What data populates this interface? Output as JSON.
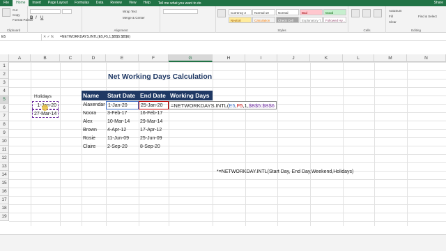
{
  "ribbon_tabs": [
    "File",
    "Home",
    "Insert",
    "Page Layout",
    "Formulas",
    "Data",
    "Review",
    "View",
    "Help"
  ],
  "active_tab": "Home",
  "tell_me": "Tell me what you want to do",
  "share": "Share",
  "clipboard": {
    "cut": "Cut",
    "copy": "Copy",
    "format_painter": "Format Painter",
    "label": "Clipboard"
  },
  "alignment": {
    "wrap": "Wrap Text",
    "merge": "Merge & Center",
    "label": "Alignment"
  },
  "styles": {
    "items": [
      "Currency 2",
      "Normal 10",
      "Normal",
      "Bad",
      "Good",
      "Neutral",
      "Calculation",
      "Check Cell",
      "Explanatory T...",
      "Followed Hy..."
    ],
    "cond": "Conditional Formatting",
    "format_table": "Format as Table",
    "label": "Styles"
  },
  "cells_group": {
    "label": "Cells"
  },
  "editing": {
    "autosum": "AutoSum",
    "fill": "Fill",
    "clear": "Clear",
    "sort": "Sort & Filter",
    "find": "Find & Select",
    "label": "Editing"
  },
  "name_box": "E5",
  "formula": "=NETWORKDAYS.INTL(E5,F5,1,$B$5:$B$6)",
  "columns": [
    "A",
    "B",
    "C",
    "D",
    "E",
    "F",
    "G",
    "H",
    "I",
    "J",
    "K",
    "L",
    "M",
    "N"
  ],
  "rows": [
    "1",
    "2",
    "3",
    "4",
    "5",
    "6",
    "7",
    "8",
    "9",
    "10",
    "11",
    "12",
    "13",
    "14",
    "15",
    "16",
    "17",
    "18",
    "19"
  ],
  "sheet": {
    "title": "Net Working Days Calculation",
    "holidays_label": "Holidays",
    "holidays": [
      "1-Jan-20",
      "27-Mar-14"
    ],
    "headers": [
      "Name",
      "Start Date",
      "End Date",
      "Working Days"
    ],
    "rows": [
      {
        "name": "Alaxendar",
        "start": "1-Jan-20",
        "end": "25-Jan-20"
      },
      {
        "name": "Noora",
        "start": "3-Feb-17",
        "end": "16-Feb-17"
      },
      {
        "name": "Alex",
        "start": "10-Mar-14",
        "end": "29-Mar-14"
      },
      {
        "name": "Brown",
        "start": "4-Apr-12",
        "end": "17-Apr-12"
      },
      {
        "name": "Rosie",
        "start": "11-Jun-09",
        "end": "25-Jun-09"
      },
      {
        "name": "Claire",
        "start": "2-Sep-20",
        "end": "8-Sep-20"
      }
    ],
    "edit_formula": {
      "prefix": "=NETWORKDAYS.INTL(",
      "a": "E5",
      "sep1": ",",
      "b": "F5",
      "sep2": ",1,",
      "c": "$B$5:$B$6"
    },
    "note": "*=NETWORKDAY.INTL(Start Day, End Day,Weekend,Holidays)"
  },
  "colors": {
    "accent": "#217346",
    "header_fill": "#1f3864",
    "title": "#1f3864"
  }
}
